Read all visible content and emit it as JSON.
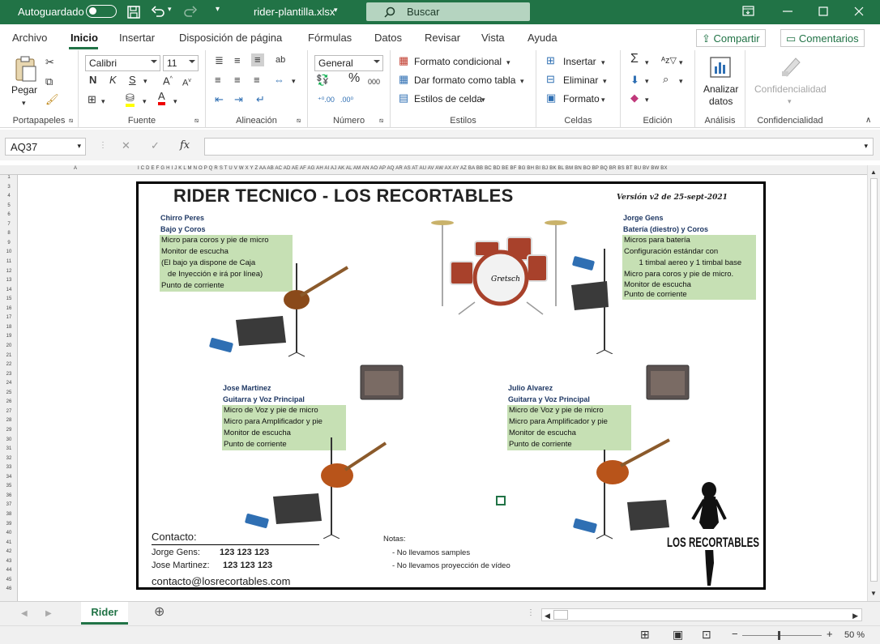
{
  "titlebar": {
    "autosave_label": "Autoguardado",
    "filename": "rider-plantilla.xlsx",
    "search": "Buscar"
  },
  "tabs": [
    "Archivo",
    "Inicio",
    "Insertar",
    "Disposición de página",
    "Fórmulas",
    "Datos",
    "Revisar",
    "Vista",
    "Ayuda"
  ],
  "share_label": "Compartir",
  "comments_label": "Comentarios",
  "ribbon": {
    "clipboard": {
      "paste": "Pegar",
      "group": "Portapapeles"
    },
    "font": {
      "name": "Calibri",
      "size": "11",
      "group": "Fuente",
      "bold": "N",
      "italic": "K",
      "underline": "S"
    },
    "alignment": {
      "group": "Alineación"
    },
    "number": {
      "format": "General",
      "group": "Número"
    },
    "styles": {
      "conditional": "Formato condicional",
      "table": "Dar formato como tabla",
      "cell_styles": "Estilos de celda",
      "group": "Estilos"
    },
    "cells": {
      "insert": "Insertar",
      "delete": "Eliminar",
      "format": "Formato",
      "group": "Celdas"
    },
    "editing": {
      "group": "Edición"
    },
    "analysis": {
      "button_line1": "Analizar",
      "button_line2": "datos",
      "group": "Análisis"
    },
    "sensitivity": {
      "button": "Confidencialidad",
      "group": "Confidencialidad"
    }
  },
  "formula_bar": {
    "name_box": "AQ37",
    "fx": "fx"
  },
  "columns": [
    "A",
    "I",
    "C",
    "D",
    "E",
    "F",
    "G",
    "H",
    "I",
    "J",
    "K",
    "L",
    "M",
    "N",
    "O",
    "P",
    "Q",
    "R",
    "S",
    "T",
    "U",
    "V",
    "W",
    "X",
    "Y",
    "Z",
    "AA",
    "AB",
    "AC",
    "AD",
    "AE",
    "AF",
    "AG",
    "AH",
    "AI",
    "AJ",
    "AK",
    "AL",
    "AM",
    "AN",
    "AO",
    "AP",
    "AQ",
    "AR",
    "AS",
    "AT",
    "AU",
    "AV",
    "AW",
    "AX",
    "AY",
    "AZ",
    "BA",
    "BB",
    "BC",
    "BD",
    "BE",
    "BF",
    "BG",
    "BH",
    "BI",
    "BJ",
    "BK",
    "BL",
    "BM",
    "BN",
    "BO",
    "BP",
    "BQ",
    "BR",
    "BS",
    "BT",
    "BU",
    "BV",
    "BW",
    "BX"
  ],
  "rows": [
    "1",
    "3",
    "4",
    "5",
    "6",
    "7",
    "8",
    "9",
    "10",
    "11",
    "12",
    "13",
    "14",
    "15",
    "16",
    "17",
    "18",
    "19",
    "20",
    "21",
    "22",
    "23",
    "24",
    "25",
    "26",
    "27",
    "28",
    "29",
    "30",
    "31",
    "32",
    "33",
    "34",
    "35",
    "36",
    "37",
    "38",
    "39",
    "40",
    "41",
    "42",
    "43",
    "44",
    "45",
    "46"
  ],
  "rider": {
    "title": "RIDER TECNICO - LOS RECORTABLES",
    "version": "Versión v2 de 25-sept-2021",
    "chirro": {
      "name": "Chirro Peres",
      "role": "Bajo y Coros",
      "items": [
        "Micro para coros y pie de micro",
        "Monitor de escucha",
        "(El bajo ya dispone de Caja",
        "   de Inyección e irá por línea)",
        "Punto de corriente"
      ]
    },
    "jorge": {
      "name": "Jorge Gens",
      "role": "Batería (diestro) y Coros",
      "items": [
        "Micros para batería",
        "Configuración estándar con",
        "       1 timbal aereo y 1 timbal base",
        "Micro para coros y pie de micro.",
        "Monitor de escucha",
        "Punto de corriente"
      ]
    },
    "jose": {
      "name": "Jose Martinez",
      "role": "Guitarra y Voz Principal",
      "items": [
        "Micro de Voz y pie de micro",
        "Micro para Amplificador y pie",
        "Monitor de escucha",
        "Punto de corriente"
      ]
    },
    "julio": {
      "name": "Julio Alvarez",
      "role": "Guitarra y Voz Principal",
      "items": [
        "Micro de Voz y pie de micro",
        "Micro para Amplificador y pie",
        "Monitor de escucha",
        "Punto de corriente"
      ]
    },
    "contact": {
      "heading": "Contacto:",
      "jorge_label": "Jorge Gens:",
      "jorge_phone": "123 123 123",
      "jose_label": "Jose Martinez:",
      "jose_phone": "123 123 123",
      "email": "contacto@losrecortables.com"
    },
    "notes": {
      "heading": "Notas:",
      "items": [
        "- No llevamos samples",
        "- No llevamos proyección de vídeo"
      ]
    },
    "logo_text": "LOS RECORTABLES",
    "drum_brand": "Gretsch"
  },
  "sheet_tab": "Rider",
  "zoom": "50 %"
}
